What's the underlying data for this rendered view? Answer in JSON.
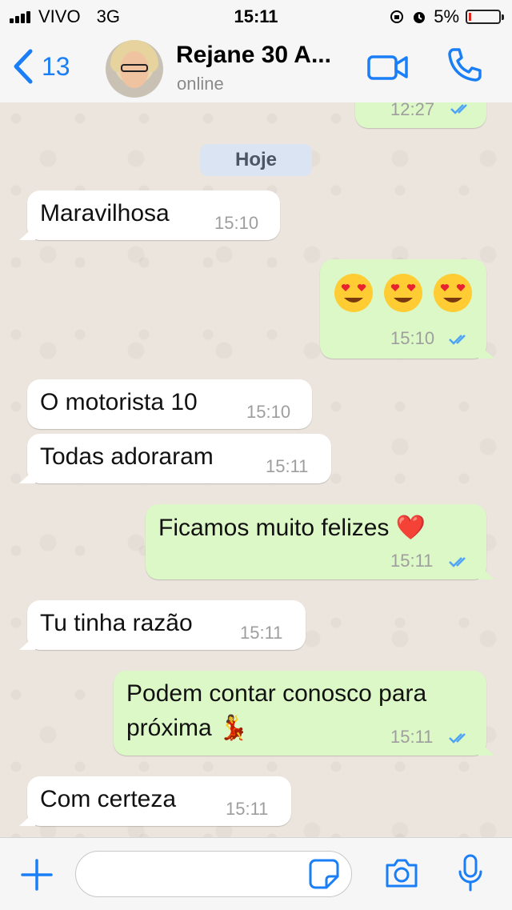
{
  "status_bar": {
    "carrier": "VIVO",
    "network": "3G",
    "time": "15:11",
    "battery": "5%"
  },
  "header": {
    "back_count": "13",
    "contact_name": "Rejane 30 A...",
    "contact_status": "online"
  },
  "chat": {
    "prev_time": "12:27",
    "date_label": "Hoje",
    "messages": [
      {
        "dir": "in",
        "text": "Maravilhosa",
        "time": "15:10"
      },
      {
        "dir": "out",
        "text": "😍😍😍",
        "time": "15:10"
      },
      {
        "dir": "in",
        "text": "O motorista 10",
        "time": "15:10"
      },
      {
        "dir": "in",
        "text": "Todas adoraram",
        "time": "15:11"
      },
      {
        "dir": "out",
        "text": "Ficamos muito felizes ❤️",
        "time": "15:11"
      },
      {
        "dir": "in",
        "text": "Tu tinha razão",
        "time": "15:11"
      },
      {
        "dir": "out",
        "text": "Podem contar conosco para",
        "text2": "próxima 💃",
        "time": "15:11"
      },
      {
        "dir": "in",
        "text": "Com certeza",
        "time": "15:11"
      }
    ]
  },
  "input": {
    "value": "",
    "placeholder": ""
  },
  "colors": {
    "accent": "#1a7ef7",
    "outgoing_bubble": "#dcf8c6",
    "incoming_bubble": "#ffffff",
    "read_ticks": "#4fa3f7"
  },
  "icons": [
    "signal-icon",
    "alarm-icon",
    "battery-icon",
    "back-chevron-icon",
    "video-camera-icon",
    "phone-icon",
    "double-check-icon",
    "plus-icon",
    "sticker-icon",
    "camera-icon",
    "microphone-icon"
  ]
}
